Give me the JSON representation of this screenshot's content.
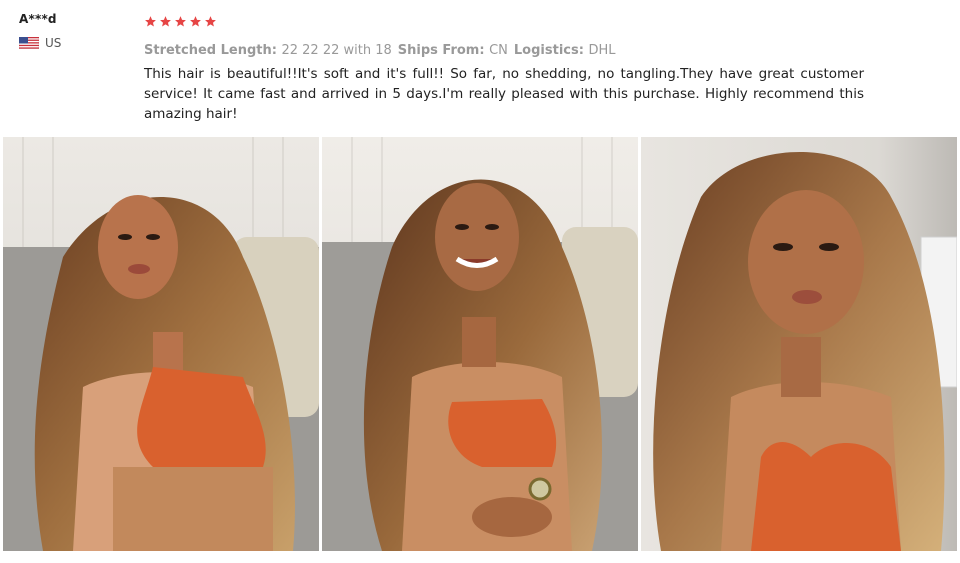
{
  "reviewer": {
    "name": "A***d",
    "country": "US"
  },
  "review": {
    "rating": 5,
    "rating_max": 5,
    "star_color": "#e64545",
    "attributes": [
      {
        "key": "Stretched Length:",
        "value": "22 22 22 with 18"
      },
      {
        "key": "Ships From:",
        "value": "CN"
      },
      {
        "key": "Logistics:",
        "value": "DHL"
      }
    ],
    "text": "This hair is beautiful!!It's soft and it's full!! So far, no shedding, no tangling.They have great customer service! It came fast and arrived in 5 days.I'm really pleased with this purchase. Highly recommend this amazing hair!"
  },
  "photos": [
    {
      "name": "review-photo-1"
    },
    {
      "name": "review-photo-2"
    },
    {
      "name": "review-photo-3"
    }
  ]
}
